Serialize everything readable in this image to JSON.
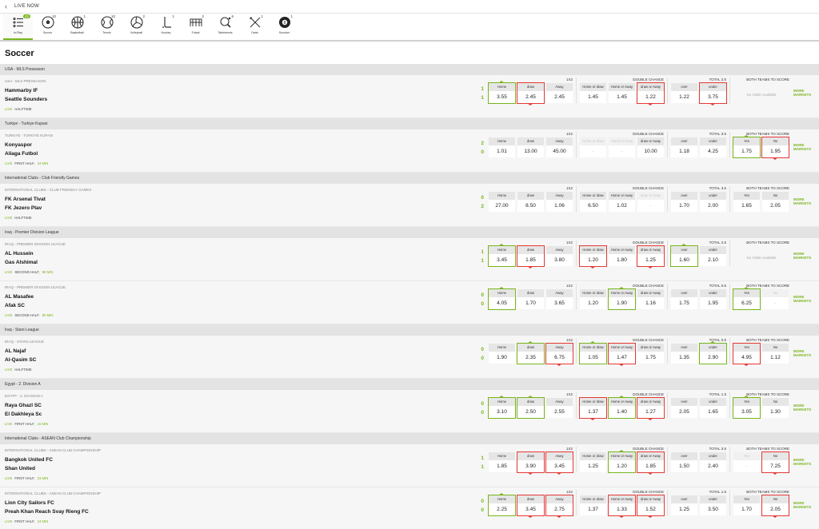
{
  "topbar": {
    "back_icon": "chevron-left-icon",
    "title": "LIVE NOW"
  },
  "sports": [
    {
      "label": "In-Play",
      "count": "42",
      "icon": "list-icon",
      "active": true
    },
    {
      "label": "Soccer",
      "count": "10",
      "icon": "soccer-ball-icon"
    },
    {
      "label": "Basketball",
      "count": "1",
      "icon": "basketball-icon"
    },
    {
      "label": "Tennis",
      "count": "10",
      "icon": "tennis-ball-icon"
    },
    {
      "label": "Volleyball",
      "count": "2",
      "icon": "volleyball-icon"
    },
    {
      "label": "Hockey",
      "count": "1",
      "icon": "hockey-stick-icon"
    },
    {
      "label": "Futsal",
      "count": "2",
      "icon": "futsal-goal-icon"
    },
    {
      "label": "Tabletennis",
      "count": "6",
      "icon": "table-tennis-icon"
    },
    {
      "label": "Darts",
      "count": "1",
      "icon": "darts-icon"
    },
    {
      "label": "Snooker",
      "count": "1",
      "icon": "snooker-ball-icon"
    }
  ],
  "page_title": "Soccer",
  "accent_color": "#7ab51d",
  "down_color": "#e53935",
  "rows": [
    {
      "kind": "league",
      "name": "USA - MLS Preseason"
    },
    {
      "kind": "match",
      "label": "USA - MLS PRESEASON",
      "home": "Hammarby IF",
      "away": "Seattle Sounders",
      "score_home": "1",
      "score_away": "1",
      "live": "LIVE",
      "period": "HALFTIME",
      "minute": "",
      "x12": {
        "header": "1X2",
        "cells": [
          {
            "label": "Home",
            "odd": "3.55",
            "state": "up"
          },
          {
            "label": "draw",
            "odd": "2.45",
            "state": "down"
          },
          {
            "label": "Away",
            "odd": "2.45",
            "state": ""
          }
        ]
      },
      "dc": {
        "header": "DOUBLE CHANCE",
        "cells": [
          {
            "label": "Home or draw",
            "odd": "1.45",
            "state": ""
          },
          {
            "label": "Home or Away",
            "odd": "1.45",
            "state": ""
          },
          {
            "label": "draw or Away",
            "odd": "1.22",
            "state": "down"
          }
        ]
      },
      "tot": {
        "header": "TOTAL 2.5",
        "cells": [
          {
            "label": "over",
            "odd": "1.22",
            "state": ""
          },
          {
            "label": "under",
            "odd": "3.75",
            "state": "down"
          }
        ]
      },
      "btts": {
        "header": "BOTH TEAMS TO SCORE",
        "na": "No Odds Available",
        "cells": []
      },
      "more": "MORE MARKETS"
    },
    {
      "kind": "league",
      "name": "Turkiye - Turkiye Kupasi"
    },
    {
      "kind": "match",
      "label": "TURKIYE - TURKIYE KUPASI",
      "home": "Konyaspor",
      "away": "Aliaga Futbol",
      "score_home": "2",
      "score_away": "0",
      "live": "LIVE",
      "period": "FIRST HALF,",
      "minute": "24 MIN",
      "x12": {
        "header": "1X2",
        "cells": [
          {
            "label": "Home",
            "odd": "1.01",
            "state": ""
          },
          {
            "label": "draw",
            "odd": "13.00",
            "state": ""
          },
          {
            "label": "Away",
            "odd": "45.00",
            "state": ""
          }
        ]
      },
      "dc": {
        "header": "DOUBLE CHANCE",
        "cells": [
          {
            "label": "Home or draw",
            "odd": "-",
            "state": "dis"
          },
          {
            "label": "Home or Away",
            "odd": "-",
            "state": "dis"
          },
          {
            "label": "draw or Away",
            "odd": "10.00",
            "state": ""
          }
        ]
      },
      "tot": {
        "header": "TOTAL 3.5",
        "cells": [
          {
            "label": "over",
            "odd": "1.18",
            "state": ""
          },
          {
            "label": "under",
            "odd": "4.25",
            "state": ""
          }
        ]
      },
      "btts": {
        "header": "BOTH TEAMS TO SCORE",
        "na": "",
        "cells": [
          {
            "label": "Yes",
            "odd": "1.75",
            "state": "up"
          },
          {
            "label": "No",
            "odd": "1.95",
            "state": "down"
          }
        ]
      },
      "more": "MORE MARKETS"
    },
    {
      "kind": "league",
      "name": "International Clubs - Club Friendly Games"
    },
    {
      "kind": "match",
      "label": "INTERNATIONAL CLUBS - CLUB FRIENDLY GAMES",
      "home": "FK Arsenal Tivat",
      "away": "FK Jezero Plav",
      "score_home": "0",
      "score_away": "2",
      "live": "LIVE",
      "period": "HALFTIME",
      "minute": "",
      "x12": {
        "header": "1X2",
        "cells": [
          {
            "label": "Home",
            "odd": "27.00",
            "state": ""
          },
          {
            "label": "draw",
            "odd": "8.50",
            "state": ""
          },
          {
            "label": "Away",
            "odd": "1.06",
            "state": ""
          }
        ]
      },
      "dc": {
        "header": "DOUBLE CHANCE",
        "cells": [
          {
            "label": "Home or draw",
            "odd": "6.50",
            "state": ""
          },
          {
            "label": "Home or Away",
            "odd": "1.02",
            "state": ""
          },
          {
            "label": "draw or Away",
            "odd": "-",
            "state": "dis"
          }
        ]
      },
      "tot": {
        "header": "TOTAL 3.5",
        "cells": [
          {
            "label": "over",
            "odd": "1.70",
            "state": ""
          },
          {
            "label": "under",
            "odd": "2.00",
            "state": ""
          }
        ]
      },
      "btts": {
        "header": "BOTH TEAMS TO SCORE",
        "na": "",
        "cells": [
          {
            "label": "Yes",
            "odd": "1.65",
            "state": ""
          },
          {
            "label": "No",
            "odd": "2.05",
            "state": ""
          }
        ]
      },
      "more": "MORE MARKETS"
    },
    {
      "kind": "league",
      "name": "Iraq - Premier Division League"
    },
    {
      "kind": "match",
      "label": "IRAQ - PREMIER DIVISION LEAGUE",
      "home": "AL Hussein",
      "away": "Gas Alshimal",
      "score_home": "1",
      "score_away": "1",
      "live": "LIVE",
      "period": "SECOND HALF,",
      "minute": "98 MIN",
      "x12": {
        "header": "1X2",
        "cells": [
          {
            "label": "Home",
            "odd": "3.45",
            "state": "up"
          },
          {
            "label": "draw",
            "odd": "1.85",
            "state": "down"
          },
          {
            "label": "Away",
            "odd": "3.80",
            "state": ""
          }
        ]
      },
      "dc": {
        "header": "DOUBLE CHANCE",
        "cells": [
          {
            "label": "Home or draw",
            "odd": "1.20",
            "state": "down"
          },
          {
            "label": "Home or Away",
            "odd": "1.80",
            "state": ""
          },
          {
            "label": "draw or Away",
            "odd": "1.25",
            "state": "down"
          }
        ]
      },
      "tot": {
        "header": "TOTAL 2.5",
        "cells": [
          {
            "label": "over",
            "odd": "1.60",
            "state": "up"
          },
          {
            "label": "under",
            "odd": "2.10",
            "state": ""
          }
        ]
      },
      "btts": {
        "header": "BOTH TEAMS TO SCORE",
        "na": "No Odds Available",
        "cells": []
      },
      "more": "MORE MARKETS"
    },
    {
      "kind": "match",
      "label": "IRAQ - PREMIER DIVISION LEAGUE",
      "home": "AL Masafee",
      "away": "Afak SC",
      "score_home": "0",
      "score_away": "0",
      "live": "LIVE",
      "period": "SECOND HALF,",
      "minute": "90 MIN",
      "x12": {
        "header": "1X2",
        "cells": [
          {
            "label": "Home",
            "odd": "4.05",
            "state": "up"
          },
          {
            "label": "draw",
            "odd": "1.70",
            "state": ""
          },
          {
            "label": "Away",
            "odd": "3.65",
            "state": ""
          }
        ]
      },
      "dc": {
        "header": "DOUBLE CHANCE",
        "cells": [
          {
            "label": "Home or draw",
            "odd": "1.20",
            "state": ""
          },
          {
            "label": "Home or Away",
            "odd": "1.90",
            "state": "up"
          },
          {
            "label": "draw or Away",
            "odd": "1.16",
            "state": ""
          }
        ]
      },
      "tot": {
        "header": "TOTAL 0.5",
        "cells": [
          {
            "label": "over",
            "odd": "1.75",
            "state": ""
          },
          {
            "label": "under",
            "odd": "1.95",
            "state": ""
          }
        ]
      },
      "btts": {
        "header": "BOTH TEAMS TO SCORE",
        "na": "",
        "cells": [
          {
            "label": "Yes",
            "odd": "6.25",
            "state": "up"
          },
          {
            "label": "No",
            "odd": "-",
            "state": "dis"
          }
        ]
      },
      "more": "MORE MARKETS"
    },
    {
      "kind": "league",
      "name": "Iraq - Stars League"
    },
    {
      "kind": "match",
      "label": "IRAQ - STARS LEAGUE",
      "home": "AL Najaf",
      "away": "Al-Qasim SC",
      "score_home": "0",
      "score_away": "0",
      "live": "LIVE",
      "period": "HALFTIME",
      "minute": "",
      "x12": {
        "header": "1X2",
        "cells": [
          {
            "label": "Home",
            "odd": "1.90",
            "state": ""
          },
          {
            "label": "draw",
            "odd": "2.35",
            "state": "up"
          },
          {
            "label": "Away",
            "odd": "6.75",
            "state": "down"
          }
        ]
      },
      "dc": {
        "header": "DOUBLE CHANCE",
        "cells": [
          {
            "label": "Home or draw",
            "odd": "1.05",
            "state": "up"
          },
          {
            "label": "Home or Away",
            "odd": "1.47",
            "state": "down"
          },
          {
            "label": "draw or Away",
            "odd": "1.75",
            "state": ""
          }
        ]
      },
      "tot": {
        "header": "TOTAL 0.5",
        "cells": [
          {
            "label": "over",
            "odd": "1.35",
            "state": ""
          },
          {
            "label": "under",
            "odd": "2.90",
            "state": "up"
          }
        ]
      },
      "btts": {
        "header": "BOTH TEAMS TO SCORE",
        "na": "",
        "cells": [
          {
            "label": "Yes",
            "odd": "4.95",
            "state": "down"
          },
          {
            "label": "No",
            "odd": "1.12",
            "state": ""
          }
        ]
      },
      "more": "MORE MARKETS"
    },
    {
      "kind": "league",
      "name": "Egypt - 2. Division A"
    },
    {
      "kind": "match",
      "label": "EGYPT - 2. DIVISION A",
      "home": "Raya Ghazl SC",
      "away": "El Dakhleya Sc",
      "score_home": "0",
      "score_away": "0",
      "live": "LIVE",
      "period": "FIRST HALF,",
      "minute": "15 MIN",
      "x12": {
        "header": "1X2",
        "cells": [
          {
            "label": "Home",
            "odd": "3.10",
            "state": "up"
          },
          {
            "label": "draw",
            "odd": "2.50",
            "state": "up"
          },
          {
            "label": "Away",
            "odd": "2.55",
            "state": ""
          }
        ]
      },
      "dc": {
        "header": "DOUBLE CHANCE",
        "cells": [
          {
            "label": "Home or draw",
            "odd": "1.37",
            "state": "down"
          },
          {
            "label": "Home or Away",
            "odd": "1.40",
            "state": "up"
          },
          {
            "label": "draw or Away",
            "odd": "1.27",
            "state": "down"
          }
        ]
      },
      "tot": {
        "header": "TOTAL 1.5",
        "cells": [
          {
            "label": "over",
            "odd": "2.05",
            "state": ""
          },
          {
            "label": "under",
            "odd": "1.65",
            "state": ""
          }
        ]
      },
      "btts": {
        "header": "BOTH TEAMS TO SCORE",
        "na": "",
        "cells": [
          {
            "label": "Yes",
            "odd": "3.05",
            "state": "up"
          },
          {
            "label": "No",
            "odd": "1.30",
            "state": ""
          }
        ]
      },
      "more": "MORE MARKETS"
    },
    {
      "kind": "league",
      "name": "International Clubs - ASEAN Club Championship"
    },
    {
      "kind": "match",
      "label": "INTERNATIONAL CLUBS - ASEAN CLUB CHAMPIONSHIP",
      "home": "Bangkok United FC",
      "away": "Shan United",
      "score_home": "1",
      "score_away": "1",
      "live": "LIVE",
      "period": "FIRST HALF,",
      "minute": "23 MIN",
      "x12": {
        "header": "1X2",
        "cells": [
          {
            "label": "Home",
            "odd": "1.85",
            "state": ""
          },
          {
            "label": "draw",
            "odd": "3.90",
            "state": "down"
          },
          {
            "label": "Away",
            "odd": "3.45",
            "state": "down"
          }
        ]
      },
      "dc": {
        "header": "DOUBLE CHANCE",
        "cells": [
          {
            "label": "Home or draw",
            "odd": "1.25",
            "state": ""
          },
          {
            "label": "Home or Away",
            "odd": "1.20",
            "state": "up"
          },
          {
            "label": "draw or Away",
            "odd": "1.85",
            "state": "down"
          }
        ]
      },
      "tot": {
        "header": "TOTAL 3.5",
        "cells": [
          {
            "label": "over",
            "odd": "1.50",
            "state": ""
          },
          {
            "label": "under",
            "odd": "2.40",
            "state": ""
          }
        ]
      },
      "btts": {
        "header": "BOTH TEAMS TO SCORE",
        "na": "",
        "cells": [
          {
            "label": "Yes",
            "odd": "-",
            "state": "dis"
          },
          {
            "label": "No",
            "odd": "7.25",
            "state": "down"
          }
        ]
      },
      "more": "MORE MARKETS"
    },
    {
      "kind": "match",
      "label": "INTERNATIONAL CLUBS - ASEAN CLUB CHAMPIONSHIP",
      "home": "Lion City Sailors FC",
      "away": "Preah Khan Reach Svay Rieng FC",
      "score_home": "0",
      "score_away": "0",
      "live": "LIVE",
      "period": "FIRST HALF,",
      "minute": "24 MIN",
      "x12": {
        "header": "1X2",
        "cells": [
          {
            "label": "Home",
            "odd": "2.25",
            "state": "up"
          },
          {
            "label": "draw",
            "odd": "3.45",
            "state": "down"
          },
          {
            "label": "Away",
            "odd": "2.75",
            "state": "down"
          }
        ]
      },
      "dc": {
        "header": "DOUBLE CHANCE",
        "cells": [
          {
            "label": "Home or draw",
            "odd": "1.37",
            "state": ""
          },
          {
            "label": "Home or Away",
            "odd": "1.33",
            "state": "down"
          },
          {
            "label": "draw or Away",
            "odd": "1.52",
            "state": "down"
          }
        ]
      },
      "tot": {
        "header": "TOTAL 1.5",
        "cells": [
          {
            "label": "over",
            "odd": "1.25",
            "state": ""
          },
          {
            "label": "under",
            "odd": "3.50",
            "state": ""
          }
        ]
      },
      "btts": {
        "header": "BOTH TEAMS TO SCORE",
        "na": "",
        "cells": [
          {
            "label": "Yes",
            "odd": "1.70",
            "state": ""
          },
          {
            "label": "No",
            "odd": "2.05",
            "state": "down"
          }
        ]
      },
      "more": "MORE MARKETS"
    }
  ]
}
